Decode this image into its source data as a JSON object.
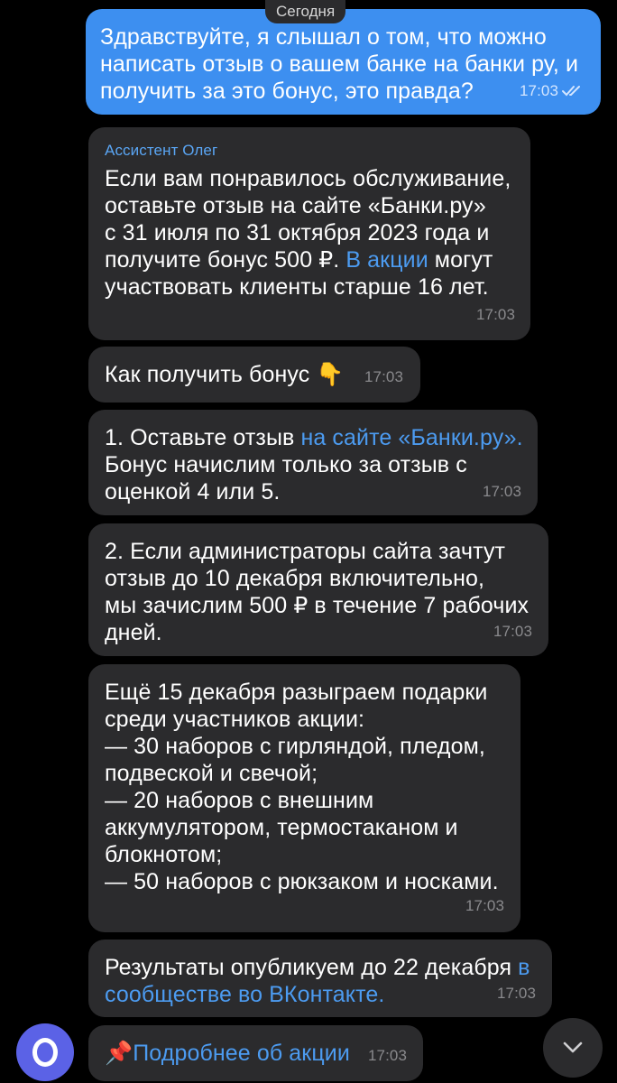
{
  "date_divider": "Сегодня",
  "messages": {
    "m1": {
      "lines": [
        "Здравствуйте, я слышал о том, что можно",
        "написать отзыв о вашем банке на банки ру, и",
        "получить за это бонус, это правда?"
      ],
      "time": "17:03"
    },
    "m2": {
      "sender": "Ассистент Олег",
      "lines": [
        "Если вам понравилось обслуживание,",
        "оставьте отзыв на сайте «Банки.ру»",
        "с 31 июля по 31 октября 2023 года и"
      ],
      "line4_pre": "получите бонус 500 ₽. ",
      "line4_link": "В акции",
      "line4_post": " могут",
      "line5": "участвовать клиенты старше 16 лет.",
      "time": "17:03"
    },
    "m3": {
      "text": "Как получить бонус",
      "emoji": "👇",
      "time": "17:03"
    },
    "m4": {
      "line1_pre": "1. Оставьте отзыв ",
      "line1_link": "на сайте «Банки.ру».",
      "lines": [
        "Бонус начислим только за отзыв с",
        "оценкой 4 или 5."
      ],
      "time": "17:03"
    },
    "m5": {
      "lines": [
        "2. Если администраторы сайта зачтут",
        "отзыв до 10 декабря включительно,",
        "мы зачислим 500 ₽ в течение 7 рабочих",
        "дней."
      ],
      "time": "17:03"
    },
    "m6": {
      "lines": [
        "Ещё 15 декабря разыграем подарки",
        "среди участников акции:",
        "— 30 наборов с гирляндой, пледом,",
        "подвеской и свечой;",
        "— 20 наборов с внешним",
        "аккумулятором, термостаканом и",
        "блокнотом;",
        "— 50 наборов с рюкзаком и носками."
      ],
      "time": "17:03"
    },
    "m7": {
      "line1_pre": "Результаты опубликуем до 22 декабря ",
      "line1_link": "в",
      "line2_link": "сообществе во ВКонтакте.",
      "time": "17:03"
    },
    "m8": {
      "emoji": "📌",
      "link": "Подробнее об акции",
      "time": "17:03"
    }
  },
  "icons": {
    "read_checks": "double-check-icon",
    "avatar": "bot-avatar-icon",
    "scroll_down": "chevron-down-icon"
  },
  "colors": {
    "background": "#000000",
    "outgoing_bubble": "#3d8ff0",
    "incoming_bubble": "#2b2b2d",
    "link": "#4c9bf0",
    "avatar": "#5b62e6"
  }
}
